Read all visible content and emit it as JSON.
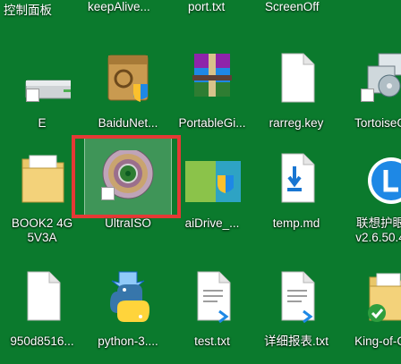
{
  "top_row": [
    "控制面板",
    "keepAlive...",
    "port.txt",
    "ScreenOff"
  ],
  "row1": {
    "e": "E",
    "baidu": "BaiduNet...",
    "portable": "PortableGi...",
    "rarreg": "rarreg.key",
    "tortoise": "TortoiseG"
  },
  "row2": {
    "book_line1": "BOOK2 4G",
    "book_line2": "5V3A",
    "ultraiso": "UltraISO",
    "aidrive": "aiDrive_...",
    "temp": "temp.md",
    "lianxiang_line1": "联想护眼",
    "lianxiang_line2": "v2.6.50.4"
  },
  "row3": {
    "file950": "950d8516...",
    "python": "python-3....",
    "test": "test.txt",
    "report": "详细报表.txt",
    "king": "King-of-G"
  },
  "colors": {
    "desktop_bg": "#0b7a2d",
    "highlight": "#e53935",
    "selection": "#a0c8aa"
  }
}
